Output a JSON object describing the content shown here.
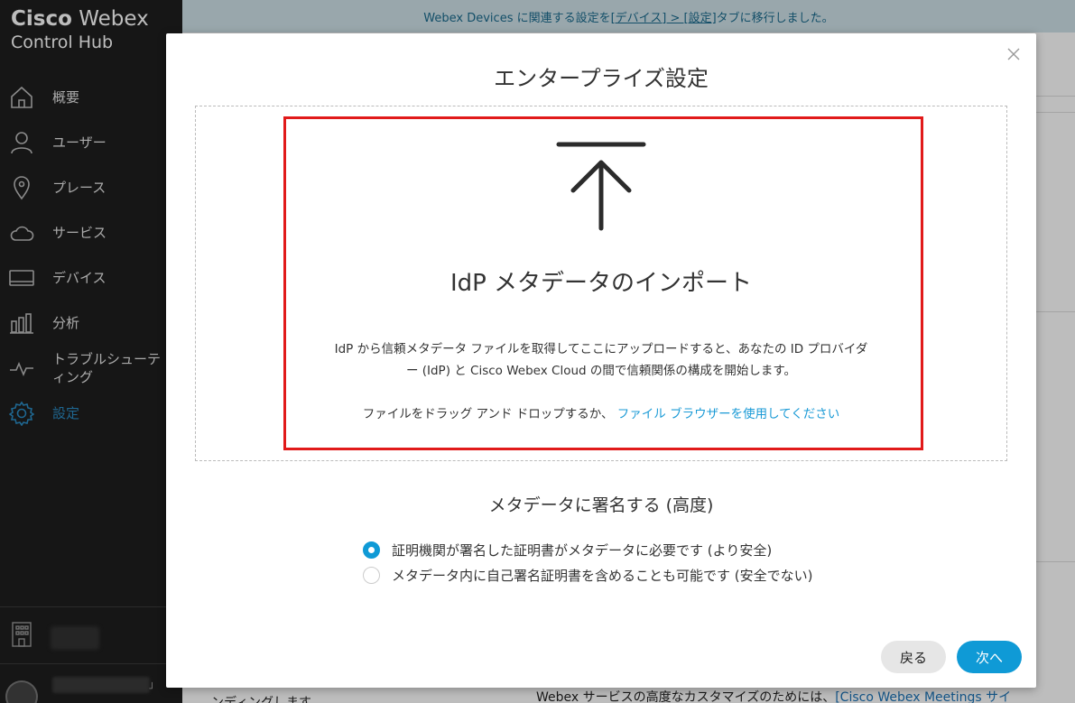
{
  "sidebar": {
    "brand_line1_bold": "Cisco",
    "brand_line1_rest": " Webex",
    "brand_line2": "Control Hub",
    "items": [
      {
        "label": "概要"
      },
      {
        "label": "ユーザー"
      },
      {
        "label": "プレース"
      },
      {
        "label": "サービス"
      },
      {
        "label": "デバイス"
      },
      {
        "label": "分析"
      },
      {
        "label": "トラブルシューティング"
      },
      {
        "label": "設定"
      }
    ]
  },
  "banner": {
    "prefix": "Webex Devices に関連する設定を ",
    "link": "[デバイス] > [設定]",
    "suffix": " タブに移行しました。"
  },
  "background": {
    "text1": "ンディングします",
    "text2_prefix": "Webex サービスの高度なカスタマイズのためには、",
    "text2_link": "[Cisco Webex Meetings サイ"
  },
  "modal": {
    "title": "エンタープライズ設定",
    "import_title": "IdP メタデータのインポート",
    "description": "IdP から信頼メタデータ ファイルを取得してここにアップロードすると、あなたの ID プロバイダー (IdP) と Cisco Webex Cloud の間で信頼関係の構成を開始します。",
    "dragdrop_text": "ファイルをドラッグ アンド ドロップするか、 ",
    "dragdrop_link": "ファイル ブラウザーを使用してください",
    "signature_title": "メタデータに署名する (高度)",
    "options": [
      {
        "label": "証明機関が署名した証明書がメタデータに必要です (より安全)",
        "checked": true
      },
      {
        "label": "メタデータ内に自己署名証明書を含めることも可能です (安全でない)",
        "checked": false
      }
    ],
    "back_label": "戻る",
    "next_label": "次へ"
  },
  "colors": {
    "accent": "#0f9ad6",
    "highlight": "#e11a1a",
    "sidebar_bg": "#1e1e1e"
  }
}
